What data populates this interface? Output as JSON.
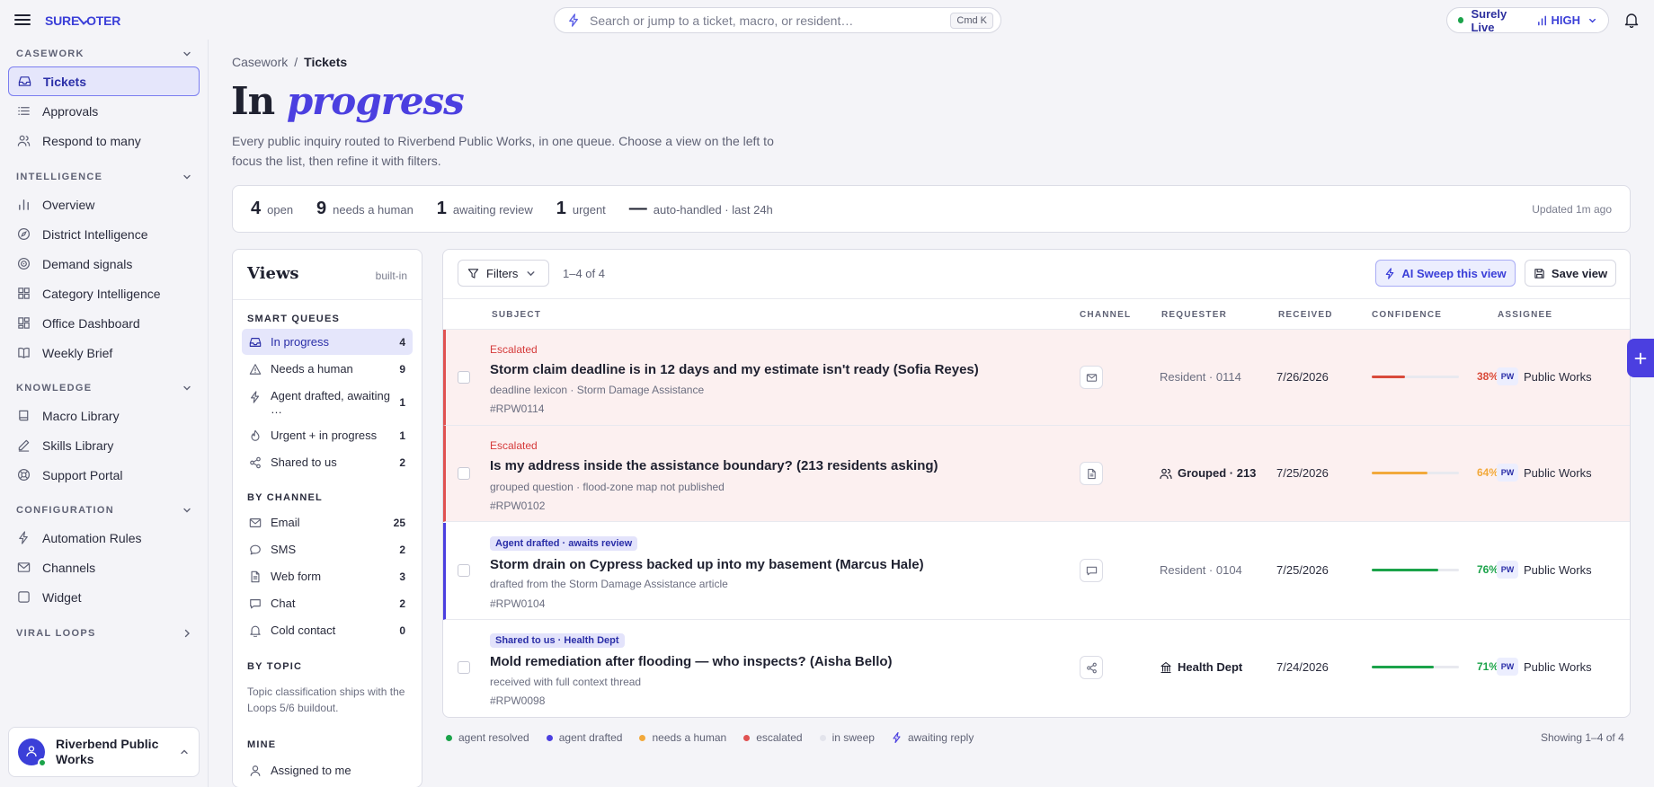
{
  "topbar": {
    "logo_a": "SURE",
    "logo_b": "OTER",
    "search_placeholder": "Search or jump to a ticket, macro, or resident…",
    "search_kbd": "Cmd K",
    "live_label": "Surely Live",
    "live_level": "HIGH"
  },
  "sidebar": {
    "casework": {
      "title": "CASEWORK",
      "items": [
        {
          "label": "Tickets"
        },
        {
          "label": "Approvals"
        },
        {
          "label": "Respond to many"
        }
      ]
    },
    "intelligence": {
      "title": "INTELLIGENCE",
      "items": [
        {
          "label": "Overview"
        },
        {
          "label": "District Intelligence"
        },
        {
          "label": "Demand signals"
        },
        {
          "label": "Category Intelligence"
        },
        {
          "label": "Office Dashboard"
        },
        {
          "label": "Weekly Brief"
        }
      ]
    },
    "knowledge": {
      "title": "KNOWLEDGE",
      "items": [
        {
          "label": "Macro Library"
        },
        {
          "label": "Skills Library"
        },
        {
          "label": "Support Portal"
        }
      ]
    },
    "configuration": {
      "title": "CONFIGURATION",
      "items": [
        {
          "label": "Automation Rules"
        },
        {
          "label": "Channels"
        },
        {
          "label": "Widget"
        }
      ]
    },
    "viral_loops": {
      "title": "VIRAL LOOPS"
    },
    "org_name": "Riverbend Public Works"
  },
  "main": {
    "breadcrumb": {
      "parent": "Casework",
      "sep": "/",
      "current": "Tickets"
    },
    "title_plain": "In ",
    "title_em": "progress",
    "description": "Every public inquiry routed to Riverbend Public Works, in one queue. Choose a view on the left to focus the list, then refine it with filters.",
    "stats": [
      {
        "n": "4",
        "l": "open"
      },
      {
        "n": "9",
        "l": "needs a human"
      },
      {
        "n": "1",
        "l": "awaiting review"
      },
      {
        "n": "1",
        "l": "urgent"
      },
      {
        "n": "—",
        "l": "auto-handled · last 24h"
      }
    ],
    "updated": "Updated 1m ago"
  },
  "views": {
    "title": "Views",
    "builtin": "built-in",
    "smart_queues": {
      "title": "SMART QUEUES",
      "items": [
        {
          "label": "In progress",
          "count": "4"
        },
        {
          "label": "Needs a human",
          "count": "9"
        },
        {
          "label": "Agent drafted, awaiting …",
          "count": "1"
        },
        {
          "label": "Urgent + in progress",
          "count": "1"
        },
        {
          "label": "Shared to us",
          "count": "2"
        }
      ]
    },
    "by_channel": {
      "title": "BY CHANNEL",
      "items": [
        {
          "label": "Email",
          "count": "25"
        },
        {
          "label": "SMS",
          "count": "2"
        },
        {
          "label": "Web form",
          "count": "3"
        },
        {
          "label": "Chat",
          "count": "2"
        },
        {
          "label": "Cold contact",
          "count": "0"
        }
      ]
    },
    "by_topic": {
      "title": "BY TOPIC",
      "note": "Topic classification ships with the Loops 5/6 buildout."
    },
    "mine": {
      "title": "MINE",
      "items": [
        {
          "label": "Assigned to me"
        }
      ]
    }
  },
  "table": {
    "filters_label": "Filters",
    "range": "1–4 of 4",
    "sweep_label": "AI Sweep this view",
    "save_label": "Save view",
    "headers": {
      "subject": "SUBJECT",
      "channel": "CHANNEL",
      "requester": "REQUESTER",
      "received": "RECEIVED",
      "confidence": "CONFIDENCE",
      "assignee": "ASSIGNEE"
    },
    "rows": [
      {
        "badge": "Escalated",
        "subject": "Storm claim deadline is in 12 days and my estimate isn't ready (Sofia Reyes)",
        "meta": "deadline lexicon · Storm Damage Assistance",
        "id": "#RPW0114",
        "channel_icon": "mail-icon",
        "requester": "Resident · 0114",
        "received": "7/26/2026",
        "confidence": 38,
        "confidence_label": "38%",
        "confidence_color": "#d94a3a",
        "assignee_initials": "PW",
        "assignee": "Public Works"
      },
      {
        "badge": "Escalated",
        "subject": "Is my address inside the assistance boundary? (213 residents asking)",
        "meta": "grouped question · flood-zone map not published",
        "id": "#RPW0102",
        "channel_icon": "document-icon",
        "requester": "Grouped · 213",
        "received": "7/25/2026",
        "confidence": 64,
        "confidence_label": "64%",
        "confidence_color": "#f2a93b",
        "assignee_initials": "PW",
        "assignee": "Public Works"
      },
      {
        "badge": "Agent drafted · awaits review",
        "subject": "Storm drain on Cypress backed up into my basement (Marcus Hale)",
        "meta": "drafted from the Storm Damage Assistance article",
        "id": "#RPW0104",
        "channel_icon": "chat-icon",
        "requester": "Resident · 0104",
        "received": "7/25/2026",
        "confidence": 76,
        "confidence_label": "76%",
        "confidence_color": "#1ba34a",
        "assignee_initials": "PW",
        "assignee": "Public Works"
      },
      {
        "badge": "Shared to us · Health Dept",
        "subject": "Mold remediation after flooding — who inspects? (Aisha Bello)",
        "meta": "received with full context thread",
        "id": "#RPW0098",
        "channel_icon": "share-icon",
        "requester": "Health Dept",
        "received": "7/24/2026",
        "confidence": 71,
        "confidence_label": "71%",
        "confidence_color": "#1ba34a",
        "assignee_initials": "PW",
        "assignee": "Public Works"
      }
    ]
  },
  "legend": [
    {
      "label": "agent resolved",
      "color": "#1ba34a"
    },
    {
      "label": "agent drafted",
      "color": "#4b3fe0"
    },
    {
      "label": "needs a human",
      "color": "#f2a93b"
    },
    {
      "label": "escalated",
      "color": "#e05252"
    },
    {
      "label": "in sweep",
      "color": "#e3e4ec"
    },
    {
      "label": "awaiting reply",
      "color": "#4b3fe0"
    }
  ],
  "showing": "Showing 1–4 of 4"
}
